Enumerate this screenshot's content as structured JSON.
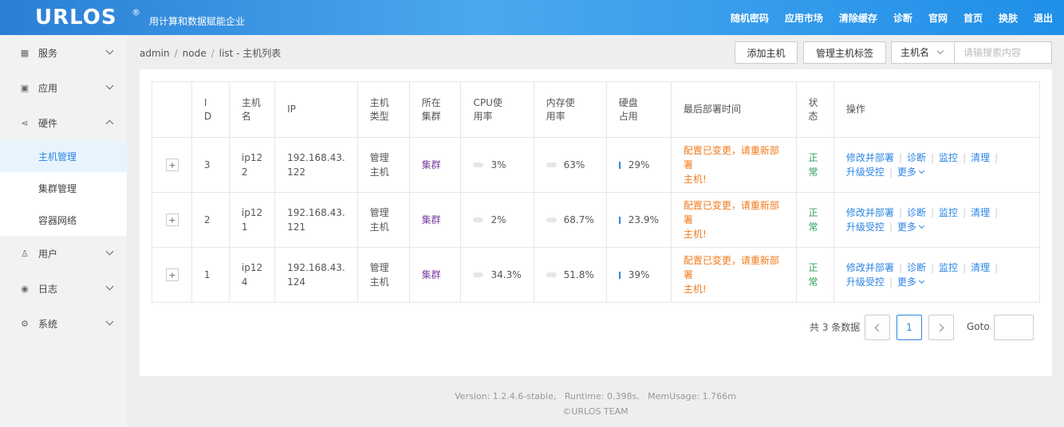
{
  "header": {
    "logo": "URLOS",
    "logo_mark": "®",
    "slogan": "用计算和数据赋能企业",
    "nav": [
      "随机密码",
      "应用市场",
      "清除缓存",
      "诊断",
      "官网",
      "首页",
      "换肤",
      "退出"
    ]
  },
  "sidebar": {
    "items": [
      {
        "label": "服务",
        "icon": "grid-icon",
        "glyph": "▦"
      },
      {
        "label": "应用",
        "icon": "apps-icon",
        "glyph": "▣"
      },
      {
        "label": "硬件",
        "icon": "share-icon",
        "glyph": "⋖"
      },
      {
        "label": "用户",
        "icon": "user-icon",
        "glyph": "♙"
      },
      {
        "label": "日志",
        "icon": "eye-icon",
        "glyph": "◉"
      },
      {
        "label": "系统",
        "icon": "gear-icon",
        "glyph": "⚙"
      }
    ],
    "submenu": [
      "主机管理",
      "集群管理",
      "容器网络"
    ],
    "active_sub": "主机管理"
  },
  "breadcrumb": [
    "admin",
    "node",
    "list"
  ],
  "breadcrumb_title": "主机列表",
  "toolbar": {
    "add_host": "添加主机",
    "manage_tags": "管理主机标签",
    "select_value": "主机名",
    "search_placeholder": "请输搜索内容"
  },
  "table": {
    "headers": [
      "I\nD",
      "主机\n名",
      "IP",
      "主机\n类型",
      "所在\n集群",
      "CPU使\n用率",
      "内存使\n用率",
      "硬盘\n占用",
      "最后部署时间",
      "状\n态",
      "操作"
    ],
    "rows": [
      {
        "id": "3",
        "name": "ip12\n2",
        "ip": "192.168.43.\n122",
        "type": "管理\n主机",
        "cluster": "集群",
        "cpu": "3%",
        "cpu_pct": 3,
        "mem": "63%",
        "mem_pct": 63,
        "disk": "29%",
        "deploy": "配置已变更，请重新部署\n主机!",
        "status": "正\n常"
      },
      {
        "id": "2",
        "name": "ip12\n1",
        "ip": "192.168.43.\n121",
        "type": "管理\n主机",
        "cluster": "集群",
        "cpu": "2%",
        "cpu_pct": 2,
        "mem": "68.7%",
        "mem_pct": 68.7,
        "disk": "23.9%",
        "deploy": "配置已变更，请重新部署\n主机!",
        "status": "正\n常"
      },
      {
        "id": "1",
        "name": "ip12\n4",
        "ip": "192.168.43.\n124",
        "type": "管理\n主机",
        "cluster": "集群",
        "cpu": "34.3%",
        "cpu_pct": 34.3,
        "mem": "51.8%",
        "mem_pct": 51.8,
        "disk": "39%",
        "deploy": "配置已变更，请重新部署\n主机!",
        "status": "正\n常"
      }
    ],
    "ops": [
      "修改并部署",
      "诊断",
      "监控",
      "清理",
      "升级受控",
      "更多"
    ]
  },
  "pager": {
    "total_text": "共 3 条数据",
    "current": "1",
    "goto_label": "Goto"
  },
  "footer": {
    "line1": "Version: 1.2.4.6-stable,   Runtime: 0.398s,   MemUsage: 1.766m",
    "line2": "©URLOS TEAM"
  },
  "colors": {
    "accent": "#2b85e4",
    "warning": "#f07a1c",
    "ok": "#2d9f5a",
    "cluster": "#7b3fa0"
  }
}
